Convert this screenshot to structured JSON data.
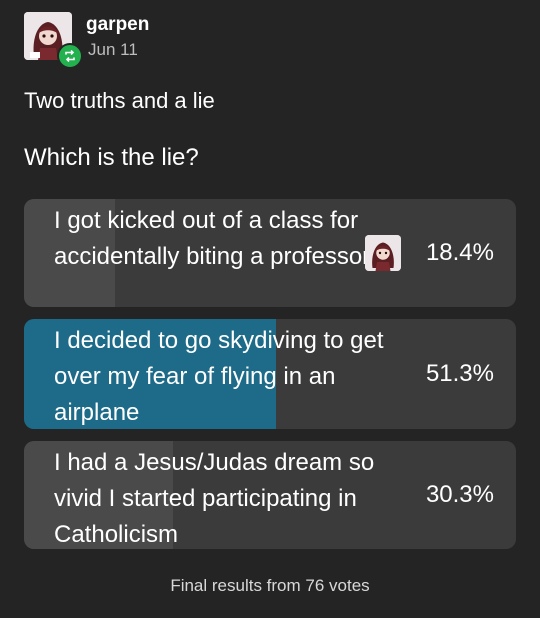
{
  "post": {
    "username": "garpen",
    "date": "Jun 11",
    "title": "Two truths and a lie",
    "question": "Which is the lie?"
  },
  "poll": {
    "options": [
      {
        "text": "I got kicked out of a class for accidentally biting a professor",
        "percent_label": "18.4%",
        "percent": 18.4,
        "selected": false,
        "voter_avatar": true
      },
      {
        "text": "I decided to go skydiving to get over my fear of flying in an airplane",
        "percent_label": "51.3%",
        "percent": 51.3,
        "selected": true,
        "voter_avatar": false
      },
      {
        "text": "I had a Jesus/Judas dream so vivid I started participating in Catholicism",
        "percent_label": "30.3%",
        "percent": 30.3,
        "selected": false,
        "voter_avatar": false
      }
    ],
    "footer": "Final results from 76 votes"
  },
  "colors": {
    "background": "#242424",
    "option_bg": "#3b3b3b",
    "result_fill": "#4a4a4a",
    "selected_fill": "#1d6b88",
    "reblog_green": "#23b14f"
  },
  "icons": {
    "reblog_badge": "reblog-icon",
    "avatar": "user-avatar"
  }
}
